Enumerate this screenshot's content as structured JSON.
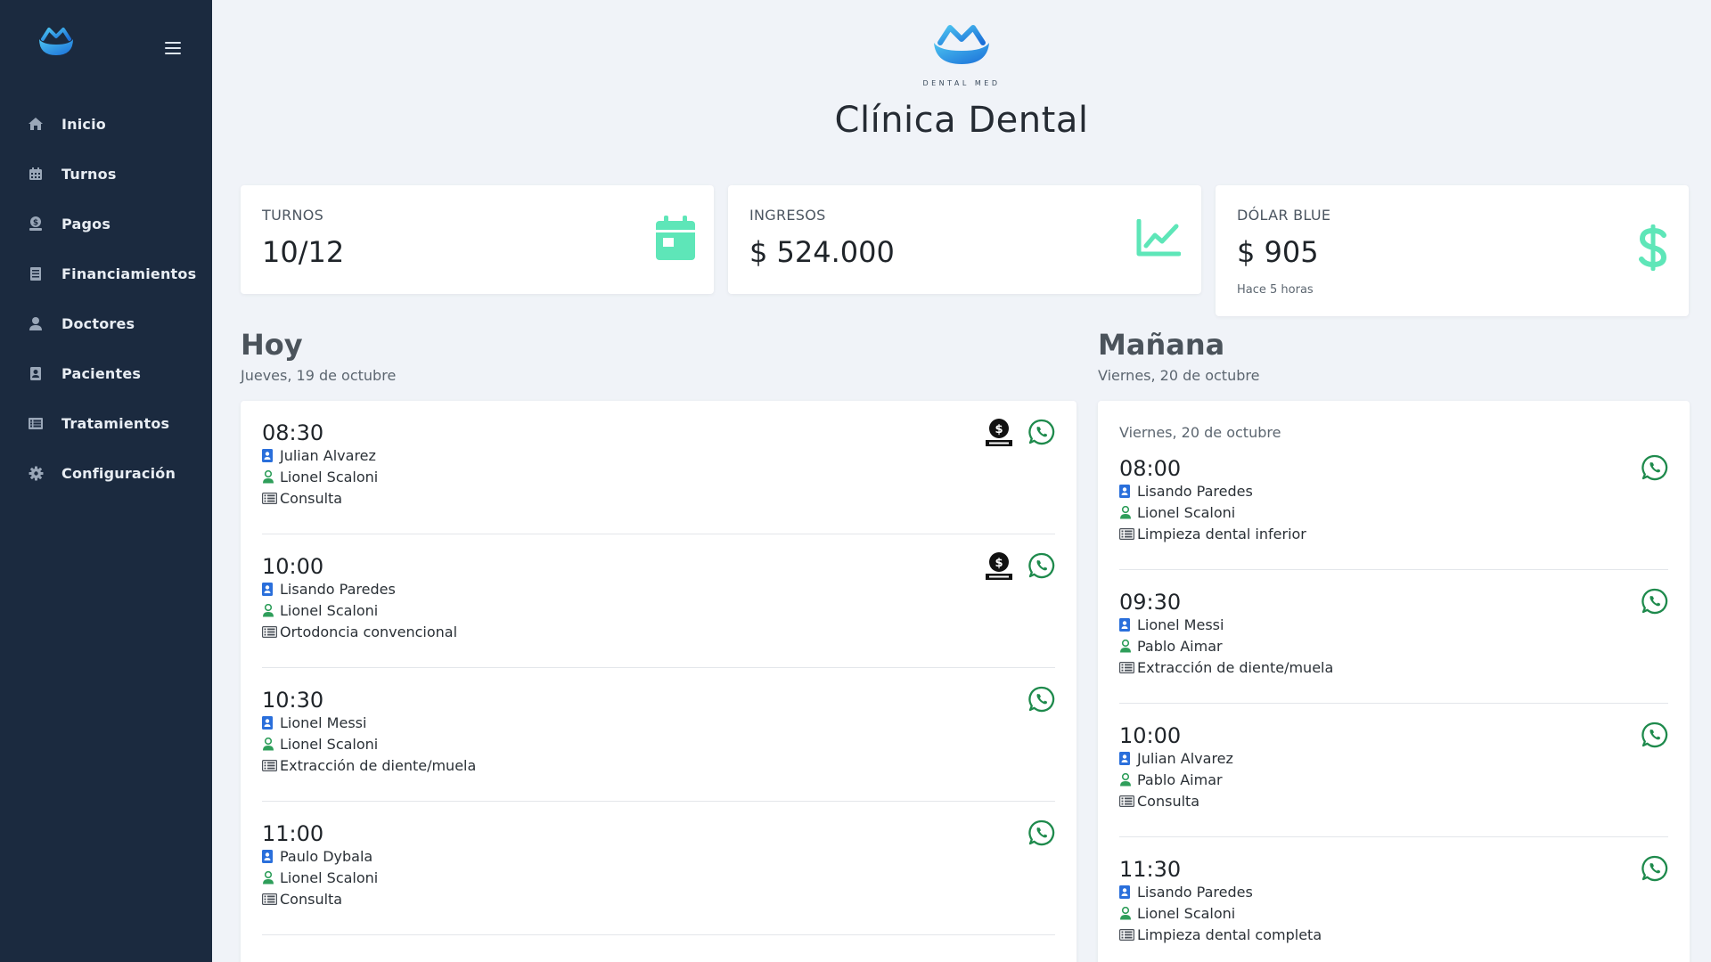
{
  "sidebar": {
    "logo_icon": "dentalmed-logo-icon",
    "menu_icon": "hamburger-icon",
    "items": [
      {
        "label": "Inicio",
        "icon": "home-icon"
      },
      {
        "label": "Turnos",
        "icon": "calendar-icon"
      },
      {
        "label": "Pagos",
        "icon": "payment-icon"
      },
      {
        "label": "Financiamientos",
        "icon": "document-icon"
      },
      {
        "label": "Doctores",
        "icon": "doctor-icon"
      },
      {
        "label": "Pacientes",
        "icon": "patient-card-icon"
      },
      {
        "label": "Tratamientos",
        "icon": "list-icon"
      },
      {
        "label": "Configuración",
        "icon": "gear-icon"
      }
    ]
  },
  "header": {
    "brand_text": "DENTAL MED",
    "title": "Clínica Dental"
  },
  "stats": {
    "turnos": {
      "label": "TURNOS",
      "value": "10/12",
      "icon": "calendar-icon",
      "color": "#5ee6b8"
    },
    "ingresos": {
      "label": "INGRESOS",
      "value": "$ 524.000",
      "icon": "chart-line-icon",
      "color": "#5ee6b8"
    },
    "dolar": {
      "label": "DÓLAR BLUE",
      "value": "$ 905",
      "sub": "Hace 5 horas",
      "icon": "dollar-icon",
      "color": "#5ee6b8"
    }
  },
  "today": {
    "title": "Hoy",
    "date": "Jueves, 19 de octubre",
    "appointments": [
      {
        "time": "08:30",
        "patient": "Julian Alvarez",
        "doctor": "Lionel Scaloni",
        "treatment": "Consulta"
      },
      {
        "time": "10:00",
        "patient": "Lisando Paredes",
        "doctor": "Lionel Scaloni",
        "treatment": "Ortodoncia convencional"
      },
      {
        "time": "10:30",
        "patient": "Lionel Messi",
        "doctor": "Lionel Scaloni",
        "treatment": "Extracción de diente/muela"
      },
      {
        "time": "11:00",
        "patient": "Paulo Dybala",
        "doctor": "Lionel Scaloni",
        "treatment": "Consulta"
      }
    ]
  },
  "tomorrow": {
    "title": "Mañana",
    "date": "Viernes, 20 de octubre",
    "panel_date": "Viernes, 20 de octubre",
    "appointments": [
      {
        "time": "08:00",
        "patient": "Lisando Paredes",
        "doctor": "Lionel Scaloni",
        "treatment": "Limpieza dental inferior"
      },
      {
        "time": "09:30",
        "patient": "Lionel Messi",
        "doctor": "Pablo Aimar",
        "treatment": "Extracción de diente/muela"
      },
      {
        "time": "10:00",
        "patient": "Julian Alvarez",
        "doctor": "Pablo Aimar",
        "treatment": "Consulta"
      },
      {
        "time": "11:30",
        "patient": "Lisando Paredes",
        "doctor": "Lionel Scaloni",
        "treatment": "Limpieza dental completa"
      }
    ]
  },
  "colors": {
    "sidebar_bg": "#1b2a3f",
    "accent_green": "#5ee6b8",
    "patient_icon": "#2a6fdb",
    "doctor_icon": "#2e9e5a",
    "whatsapp": "#1e8a4c"
  }
}
